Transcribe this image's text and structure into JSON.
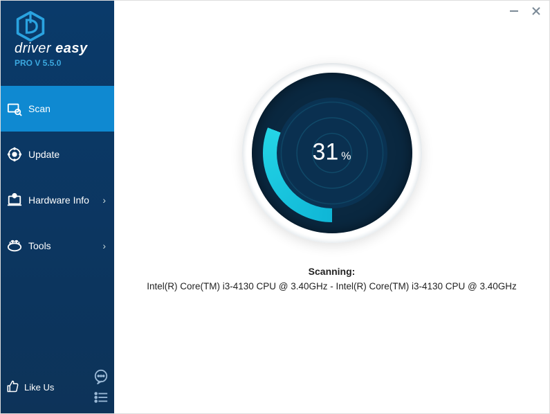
{
  "brand": {
    "word1": "driver",
    "word2": "easy"
  },
  "version": "PRO V 5.5.0",
  "nav": {
    "scan": "Scan",
    "update": "Update",
    "hwinfo": "Hardware Info",
    "tools": "Tools"
  },
  "likeus": "Like Us",
  "scan_status": {
    "percent": "31",
    "pct_sign": "%",
    "title": "Scanning:",
    "detail": "Intel(R) Core(TM) i3-4130 CPU @ 3.40GHz - Intel(R) Core(TM) i3-4130 CPU @ 3.40GHz"
  }
}
